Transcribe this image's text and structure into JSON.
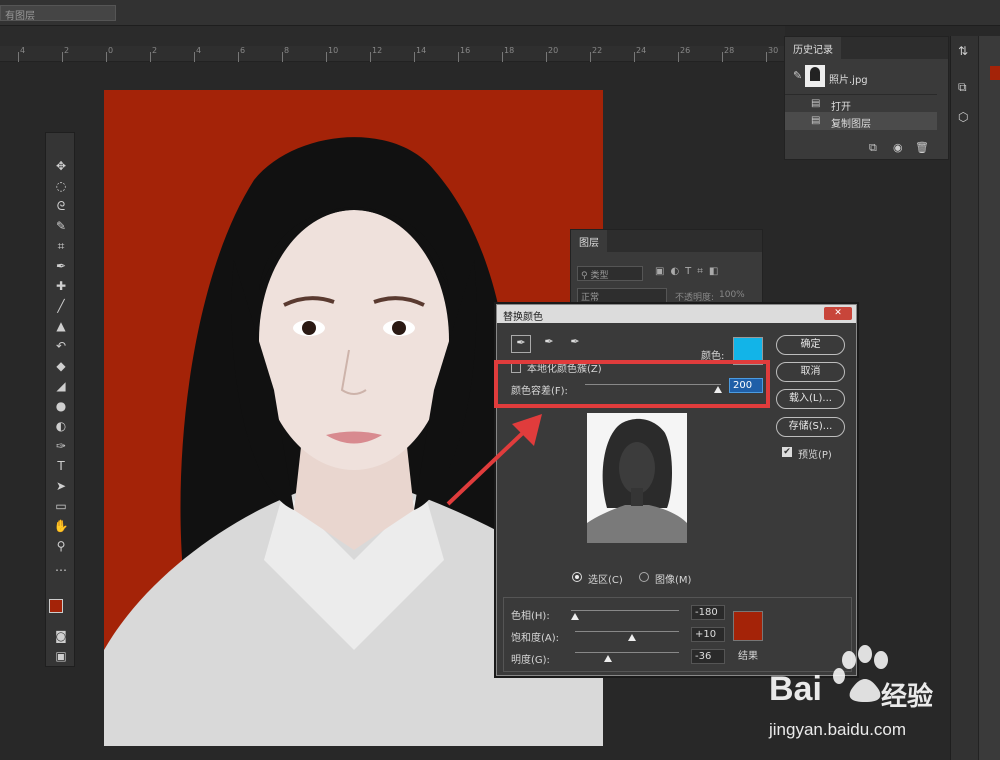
{
  "optionsbar": {
    "layer_select": "有图层"
  },
  "ruler": {
    "ticks": [
      "4",
      "2",
      "0",
      "2",
      "4",
      "6",
      "8",
      "10",
      "12",
      "14",
      "16",
      "18",
      "20",
      "22",
      "24",
      "26",
      "28",
      "30"
    ]
  },
  "history": {
    "tab": "历史记录",
    "snapshot": "照片.jpg",
    "items": [
      "打开",
      "复制图层"
    ]
  },
  "layers": {
    "tab": "图层",
    "filter": "类型",
    "blend": "正常",
    "opacity_label": "不透明度:",
    "opacity": "100%"
  },
  "dialog": {
    "title": "替换颜色",
    "color_label": "颜色:",
    "swatch_color": "#12b4e8",
    "localized_label": "本地化颜色簇(Z)",
    "fuzziness_label": "颜色容差(F):",
    "fuzziness_value": "200",
    "fuzziness_fraction": 0.98,
    "buttons": {
      "ok": "确定",
      "cancel": "取消",
      "load": "载入(L)...",
      "save": "存储(S)..."
    },
    "preview_label": "预览(P)",
    "radio_selection": "选区(C)",
    "radio_image": "图像(M)",
    "hue_label": "色相(H):",
    "hue_value": "-180",
    "hue_fraction": 0.0,
    "sat_label": "饱和度(A):",
    "sat_value": "+10",
    "sat_fraction": 0.55,
    "light_label": "明度(G):",
    "light_value": "-36",
    "light_fraction": 0.32,
    "result_label": "结果",
    "result_color": "#a42308"
  },
  "colors": {
    "foreground": "#a42308",
    "background": "#1c8bbf",
    "highlight": "#e03c3c"
  },
  "watermark": {
    "brand": "Bai",
    "brand2": "经验",
    "url": "jingyan.baidu.com"
  }
}
